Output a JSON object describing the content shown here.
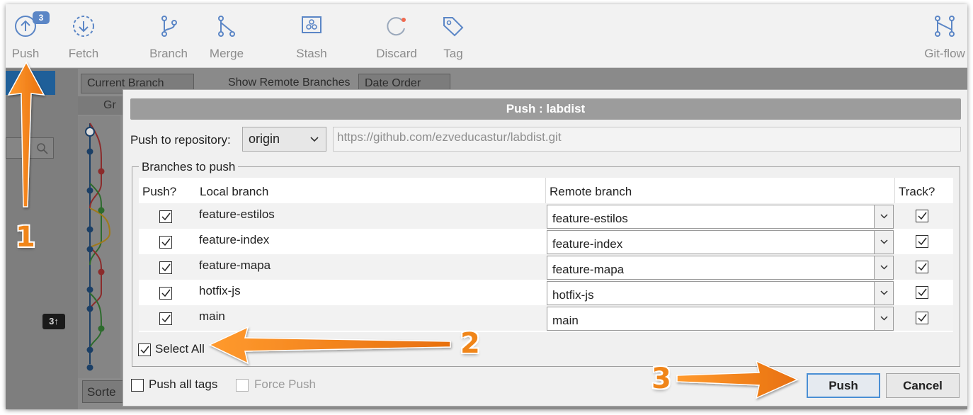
{
  "toolbar": {
    "push": {
      "label": "Push",
      "badge": "3",
      "icon": "push-icon"
    },
    "fetch": {
      "label": "Fetch",
      "icon": "fetch-icon"
    },
    "branch": {
      "label": "Branch",
      "icon": "branch-icon"
    },
    "merge": {
      "label": "Merge",
      "icon": "merge-icon"
    },
    "stash": {
      "label": "Stash",
      "icon": "stash-icon"
    },
    "discard": {
      "label": "Discard",
      "icon": "discard-icon"
    },
    "tag": {
      "label": "Tag",
      "icon": "tag-icon"
    },
    "gitflow": {
      "label": "Git-flow",
      "icon": "git-flow-icon"
    }
  },
  "background": {
    "branch_filter": "Current Branch",
    "show_remote": "Show Remote Branches",
    "order": "Date Order",
    "graph_header": "Gr",
    "sort_label": "Sorte",
    "pending_count": "3↑"
  },
  "dialog": {
    "title": "Push :  labdist",
    "repo_label": "Push to repository:",
    "repo_value": "origin",
    "repo_url": "https://github.com/ezveducastur/labdist.git",
    "branches_legend": "Branches to push",
    "columns": {
      "push": "Push?",
      "local": "Local branch",
      "remote": "Remote branch",
      "track": "Track?"
    },
    "rows": [
      {
        "local": "feature-estilos",
        "remote": "feature-estilos",
        "push": true,
        "track": true
      },
      {
        "local": "feature-index",
        "remote": "feature-index",
        "push": true,
        "track": true
      },
      {
        "local": "feature-mapa",
        "remote": "feature-mapa",
        "push": true,
        "track": true
      },
      {
        "local": "hotfix-js",
        "remote": "hotfix-js",
        "push": true,
        "track": true
      },
      {
        "local": "main",
        "remote": "main",
        "push": true,
        "track": true
      }
    ],
    "select_all": "Select All",
    "push_all_tags": "Push all tags",
    "force_push": "Force Push",
    "push_button": "Push",
    "cancel_button": "Cancel"
  },
  "annotations": {
    "step1": "1",
    "step2": "2",
    "step3": "3",
    "arrow_color": "#f08519"
  },
  "colors": {
    "accent": "#4a8fd4",
    "badge": "#5b86c6",
    "selection": "#1f5f99"
  }
}
